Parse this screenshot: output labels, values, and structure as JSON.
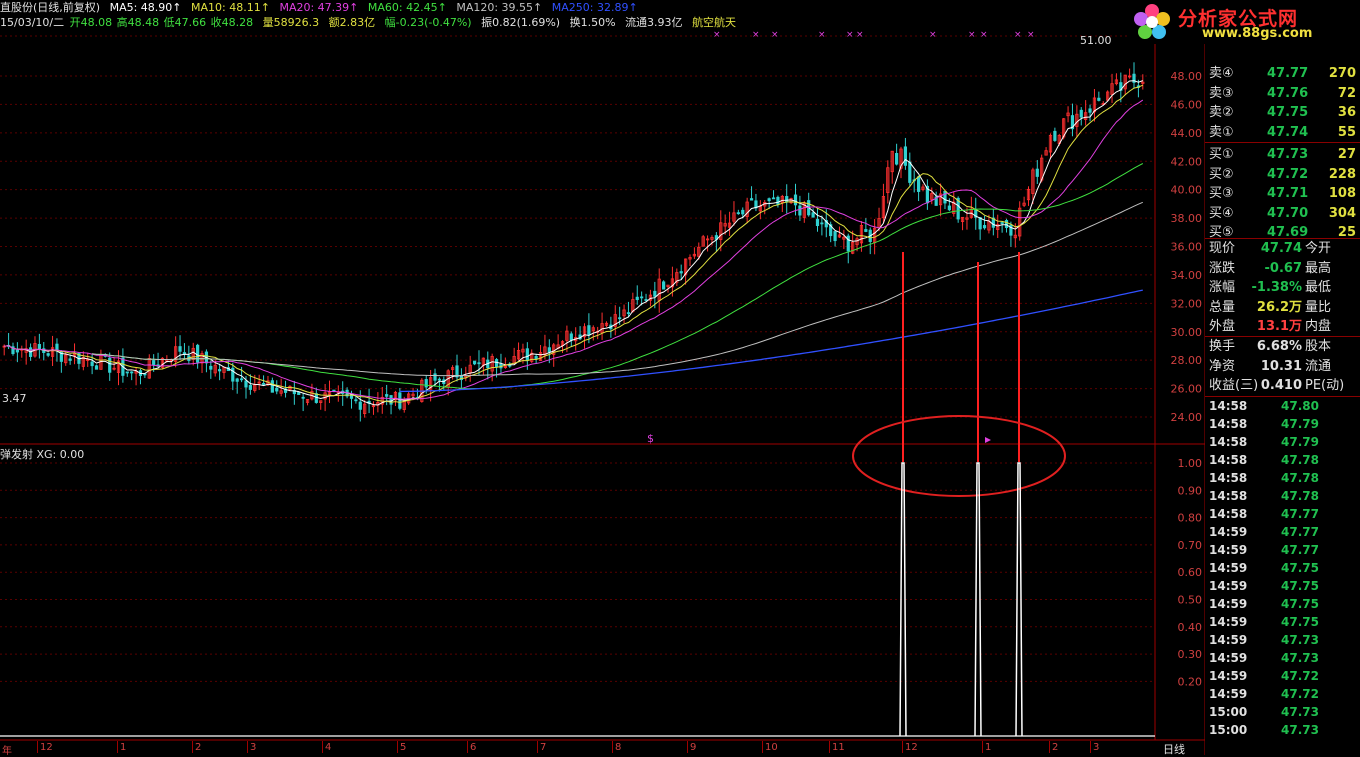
{
  "header": {
    "line1": {
      "name": "直股份(日线,前复权)",
      "ma5": "MA5: 48.90↑",
      "ma10": "MA10: 48.11↑",
      "ma20": "MA20: 47.39↑",
      "ma60": "MA60: 42.45↑",
      "ma120": "MA120: 39.55↑",
      "ma250": "MA250: 32.89↑"
    },
    "line2": {
      "date": "15/03/10/二",
      "open": "开48.08",
      "high": "高48.48",
      "low": "低47.66",
      "close": "收48.28",
      "vol": "量58926.3",
      "amount": "额2.83亿",
      "change": "幅-0.23(-0.47%)",
      "amp": "振0.82(1.69%)",
      "turnover": "换1.50%",
      "float": "流通3.93亿",
      "sector": "航空航天"
    },
    "colors": {
      "ma5": "#ffffff",
      "ma10": "#e0e040",
      "ma20": "#e040e0",
      "ma60": "#40e040",
      "ma120": "#c0c0c0",
      "ma250": "#3050ff"
    }
  },
  "price_axis": [
    "48.00",
    "46.00",
    "44.00",
    "42.00",
    "40.00",
    "38.00",
    "36.00",
    "34.00",
    "32.00",
    "30.00",
    "28.00",
    "26.00",
    "24.00"
  ],
  "price_annotations": {
    "high_label": "51.00",
    "low_label": "3.47",
    "marker": "$"
  },
  "indicator": {
    "label": "弹发射  XG: 0.00",
    "axis": [
      "1.00",
      "0.90",
      "0.80",
      "0.70",
      "0.60",
      "0.50",
      "0.40",
      "0.30",
      "0.20"
    ],
    "signals": [
      1,
      1,
      1
    ]
  },
  "time_axis": [
    "12",
    "1",
    "2",
    "3",
    "4",
    "5",
    "6",
    "7",
    "8",
    "9",
    "10",
    "11",
    "12",
    "1",
    "2",
    "3"
  ],
  "time_axis_left": "年",
  "logo": {
    "title": "分析家公式网",
    "url": "www.88gs.com"
  },
  "order_book": {
    "asks": [
      {
        "label": "卖④",
        "price": "47.77",
        "vol": "270"
      },
      {
        "label": "卖③",
        "price": "47.76",
        "vol": "72"
      },
      {
        "label": "卖②",
        "price": "47.75",
        "vol": "36"
      },
      {
        "label": "卖①",
        "price": "47.74",
        "vol": "55"
      }
    ],
    "bids": [
      {
        "label": "买①",
        "price": "47.73",
        "vol": "27"
      },
      {
        "label": "买②",
        "price": "47.72",
        "vol": "228"
      },
      {
        "label": "买③",
        "price": "47.71",
        "vol": "108"
      },
      {
        "label": "买④",
        "price": "47.70",
        "vol": "304"
      },
      {
        "label": "买⑤",
        "price": "47.69",
        "vol": "25"
      }
    ]
  },
  "quote": [
    {
      "label": "现价",
      "value": "47.74",
      "label2": "今开",
      "color": "#20c050"
    },
    {
      "label": "涨跌",
      "value": "-0.67",
      "label2": "最高",
      "color": "#20c050"
    },
    {
      "label": "涨幅",
      "value": "-1.38%",
      "label2": "最低",
      "color": "#20c050"
    },
    {
      "label": "总量",
      "value": "26.2万",
      "label2": "量比",
      "color": "#e0e040"
    },
    {
      "label": "外盘",
      "value": "13.1万",
      "label2": "内盘",
      "color": "#ff4040"
    }
  ],
  "fundamentals": [
    {
      "label": "换手",
      "value": "6.68%",
      "label2": "股本"
    },
    {
      "label": "净资",
      "value": "10.31",
      "label2": "流通"
    },
    {
      "label": "收益(三)",
      "value": "0.410",
      "label2": "PE(动)"
    }
  ],
  "ticks": [
    {
      "time": "14:58",
      "price": "47.80"
    },
    {
      "time": "14:58",
      "price": "47.79"
    },
    {
      "time": "14:58",
      "price": "47.79"
    },
    {
      "time": "14:58",
      "price": "47.78"
    },
    {
      "time": "14:58",
      "price": "47.78"
    },
    {
      "time": "14:58",
      "price": "47.78"
    },
    {
      "time": "14:58",
      "price": "47.77"
    },
    {
      "time": "14:59",
      "price": "47.77"
    },
    {
      "time": "14:59",
      "price": "47.77"
    },
    {
      "time": "14:59",
      "price": "47.75"
    },
    {
      "time": "14:59",
      "price": "47.75"
    },
    {
      "time": "14:59",
      "price": "47.75"
    },
    {
      "time": "14:59",
      "price": "47.75"
    },
    {
      "time": "14:59",
      "price": "47.73"
    },
    {
      "time": "14:59",
      "price": "47.73"
    },
    {
      "time": "14:59",
      "price": "47.72"
    },
    {
      "time": "14:59",
      "price": "47.72"
    },
    {
      "time": "15:00",
      "price": "47.73"
    },
    {
      "time": "15:00",
      "price": "47.73"
    }
  ],
  "tab": "日线"
}
